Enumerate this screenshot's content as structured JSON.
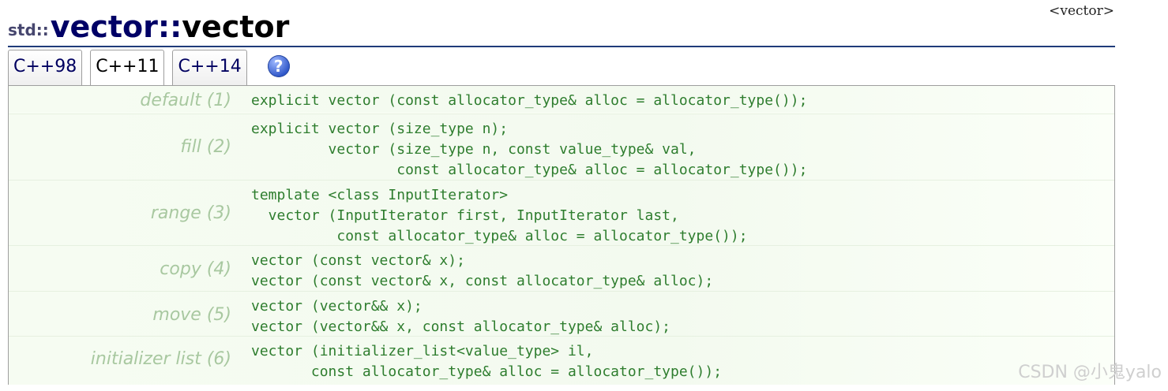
{
  "title": {
    "namespace": "std::",
    "name": "vector",
    "separator": "::",
    "function": "vector"
  },
  "header_link": "<vector>",
  "tabs": [
    {
      "label": "C++98"
    },
    {
      "label": "C++11"
    },
    {
      "label": "C++14"
    }
  ],
  "help_icon": {
    "label": "?"
  },
  "constructors": [
    {
      "label": "default (1)",
      "code": "explicit vector (const allocator_type& alloc = allocator_type());"
    },
    {
      "label": "fill (2)",
      "code": "explicit vector (size_type n);\n         vector (size_type n, const value_type& val,\n                 const allocator_type& alloc = allocator_type());"
    },
    {
      "label": "range (3)",
      "code": "template <class InputIterator>\n  vector (InputIterator first, InputIterator last,\n          const allocator_type& alloc = allocator_type());"
    },
    {
      "label": "copy (4)",
      "code": "vector (const vector& x);\nvector (const vector& x, const allocator_type& alloc);"
    },
    {
      "label": "move (5)",
      "code": "vector (vector&& x);\nvector (vector&& x, const allocator_type& alloc);"
    },
    {
      "label": "initializer list (6)",
      "code": "vector (initializer_list<value_type> il,\n       const allocator_type& alloc = allocator_type());"
    }
  ],
  "watermark": "CSDN @小鬼yalo"
}
